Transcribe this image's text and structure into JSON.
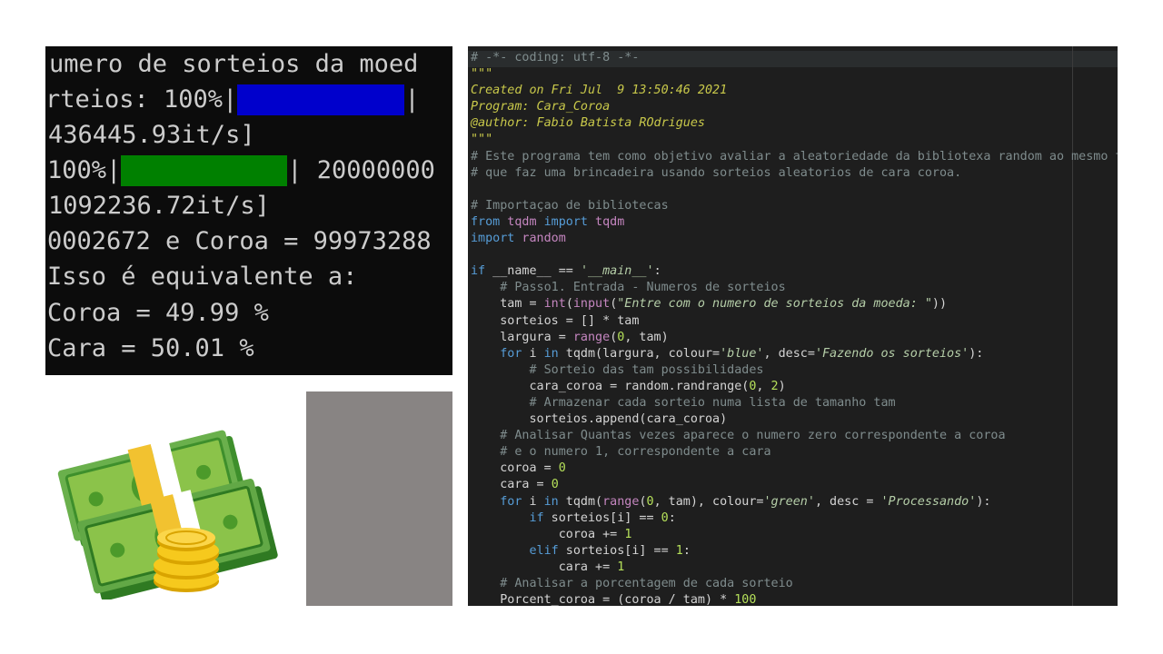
{
  "terminal": {
    "lines": [
      "umero de sorteios da moed",
      "rteios: 100%|",
      " 436445.93it/s]",
      "100%|",
      " 1092236.72it/s]",
      "0002672 e Coroa = 99973288",
      "Isso é equivalente a:",
      "Coroa = 49.99 %",
      "Cara  = 50.01 %"
    ],
    "line2_tail": "|",
    "line4_tail": "| 20000000",
    "progress_blue": 1.0,
    "progress_green": 1.0
  },
  "illustration": {
    "name": "money-stack-and-coins-icon"
  },
  "editor": {
    "lines": [
      "# -*- coding: utf-8 -*-",
      "\"\"\"",
      "Created on Fri Jul  9 13:50:46 2021",
      "Program: Cara_Coroa",
      "@author: Fabio Batista ROdrigues",
      "\"\"\"",
      "# Este programa tem como objetivo avaliar a aleatoriedade da bibliotexa random ao mesmo tempo",
      "# que faz uma brincadeira usando sorteios aleatorios de cara coroa.",
      "",
      "# Importaçao de bibliotecas",
      "from tqdm import tqdm",
      "import random",
      "",
      "if __name__ == '__main__':",
      "    # Passo1. Entrada - Numeros de sorteios",
      "    tam = int(input(\"Entre com o numero de sorteios da moeda: \"))",
      "    sorteios = [] * tam",
      "    largura = range(0, tam)",
      "    for i in tqdm(largura, colour='blue', desc='Fazendo os sorteios'):",
      "        # Sorteio das tam possibilidades",
      "        cara_coroa = random.randrange(0, 2)",
      "        # Armazenar cada sorteio numa lista de tamanho tam",
      "        sorteios.append(cara_coroa)",
      "    # Analisar Quantas vezes aparece o numero zero correspondente a coroa",
      "    # e o numero 1, correspondente a cara",
      "    coroa = 0",
      "    cara = 0",
      "    for i in tqdm(range(0, tam), colour='green', desc = 'Processando'):",
      "        if sorteios[i] == 0:",
      "            coroa += 1",
      "        elif sorteios[i] == 1:",
      "            cara += 1",
      "    # Analisar a porcentagem de cada sorteio",
      "    Porcent_coroa = (coroa / tam) * 100"
    ]
  },
  "colors": {
    "terminal_bg": "#0c0c0c",
    "editor_bg": "#1e1e1e",
    "progress_blue": "#0000cc",
    "progress_green": "#008000",
    "gray_panel": "#888483"
  }
}
